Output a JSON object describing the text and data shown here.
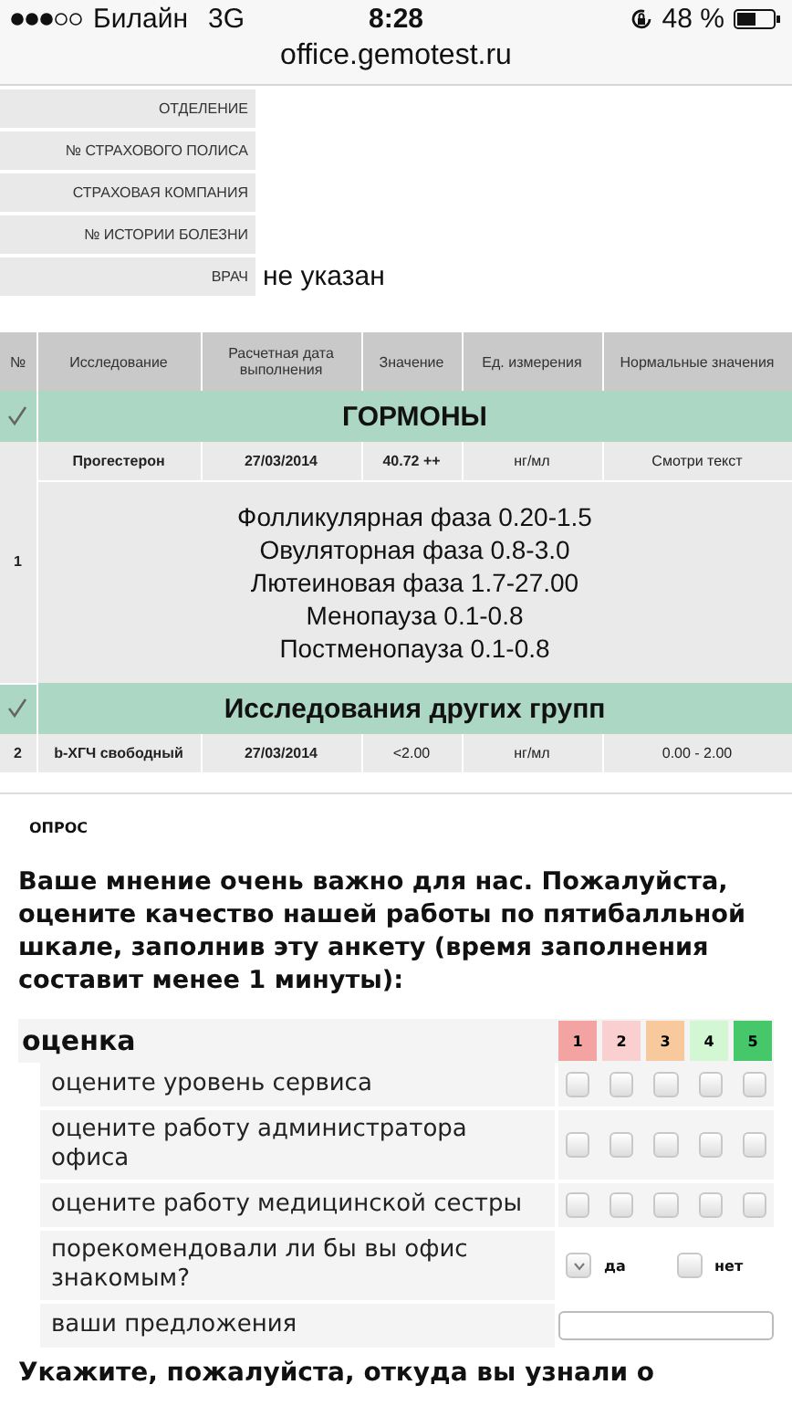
{
  "status_bar": {
    "carrier": "Билайн",
    "network": "3G",
    "time": "8:28",
    "battery": "48 %"
  },
  "url_bar": {
    "address": "office.gemotest.ru"
  },
  "patient_info": [
    {
      "label": "ОТДЕЛЕНИЕ"
    },
    {
      "label": "№ СТРАХОВОГО ПОЛИСА"
    },
    {
      "label": "СТРАХОВАЯ КОМПАНИЯ"
    },
    {
      "label": "№ ИСТОРИИ БОЛЕЗНИ"
    },
    {
      "label": "ВРАЧ",
      "value": "не указан"
    }
  ],
  "results": {
    "columns": [
      "№",
      "Исследование",
      "Расчетная дата выполнения",
      "Значение",
      "Ед. измерения",
      "Нормальные значения"
    ],
    "rows": [
      {
        "kind": "group",
        "title": "ГОРМОНЫ"
      },
      {
        "kind": "test",
        "number": "1",
        "name": "Прогестерон",
        "date": "27/03/2014",
        "value": "40.72 ++",
        "unit": "нг/мл",
        "normal": "Смотри текст",
        "notes": [
          "Фолликулярная фаза 0.20-1.5",
          "Овуляторная фаза 0.8-3.0",
          "Лютеиновая фаза 1.7-27.00",
          "Менопауза 0.1-0.8",
          "Постменопауза 0.1-0.8"
        ]
      },
      {
        "kind": "group",
        "title": "Исследования других групп"
      },
      {
        "kind": "test",
        "number": "2",
        "name": "b-ХГЧ свободный",
        "date": "27/03/2014",
        "value": "<2.00",
        "unit": "нг/мл",
        "normal": "0.00 - 2.00"
      }
    ]
  },
  "survey": {
    "section": "ОПРОС",
    "intro": "Ваше мнение очень важно для нас. Пожалуйста, оцените качество нашей работы по пятибалльной шкале, заполнив эту анкету (время заполнения составит менее 1 минуты):",
    "rating_title": "оценка",
    "scale": [
      {
        "label": "1",
        "color": "#f4a3a3"
      },
      {
        "label": "2",
        "color": "#f9cfcf"
      },
      {
        "label": "3",
        "color": "#f8c99c"
      },
      {
        "label": "4",
        "color": "#d2f7d2"
      },
      {
        "label": "5",
        "color": "#46c86a"
      }
    ],
    "questions": [
      {
        "kind": "rating",
        "text": "оцените уровень сервиса",
        "options": [
          {
            "checked": false
          },
          {
            "checked": false
          },
          {
            "checked": false
          },
          {
            "checked": false
          },
          {
            "checked": false
          }
        ]
      },
      {
        "kind": "rating",
        "text": "оцените работу администратора офиса",
        "options": [
          {
            "checked": false
          },
          {
            "checked": false
          },
          {
            "checked": false
          },
          {
            "checked": false
          },
          {
            "checked": false
          }
        ]
      },
      {
        "kind": "rating",
        "text": "оцените работу медицинской сестры",
        "options": [
          {
            "checked": false
          },
          {
            "checked": false
          },
          {
            "checked": false
          },
          {
            "checked": false
          },
          {
            "checked": false
          }
        ]
      },
      {
        "kind": "yesno",
        "text": "порекомендовали ли бы вы офис знакомым?",
        "options": [
          {
            "label": "да",
            "checked": true
          },
          {
            "label": "нет",
            "checked": false
          }
        ]
      },
      {
        "kind": "text",
        "text": "ваши предложения"
      }
    ],
    "next_question": "Укажите, пожалуйста, откуда вы узнали о"
  }
}
